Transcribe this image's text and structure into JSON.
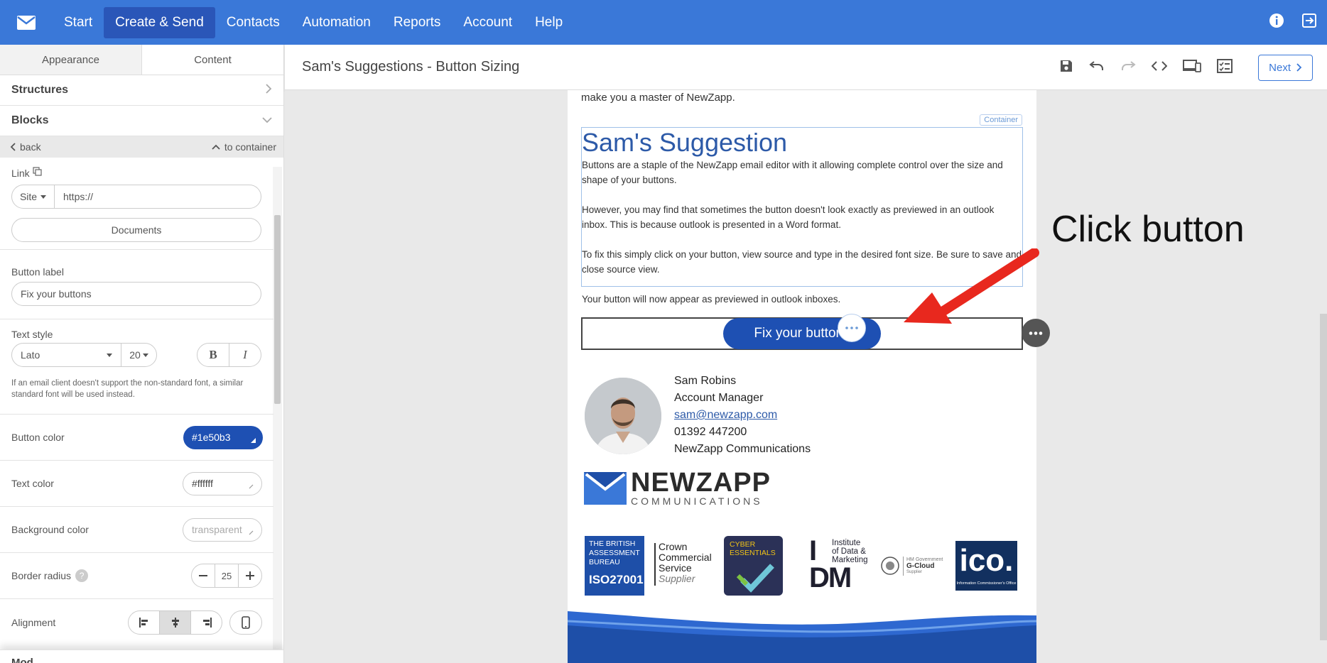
{
  "nav": {
    "items": [
      {
        "label": "Start"
      },
      {
        "label": "Create & Send"
      },
      {
        "label": "Contacts"
      },
      {
        "label": "Automation"
      },
      {
        "label": "Reports"
      },
      {
        "label": "Account"
      },
      {
        "label": "Help"
      }
    ],
    "active": "Create & Send"
  },
  "left_panel": {
    "tabs": [
      {
        "label": "Appearance"
      },
      {
        "label": "Content"
      }
    ],
    "structures_label": "Structures",
    "blocks_label": "Blocks",
    "back_label": "back",
    "to_container_label": "to container",
    "link_label": "Link",
    "link_type": "Site",
    "link_value": "https://",
    "documents_label": "Documents",
    "button_label_label": "Button label",
    "button_label_value": "Fix your buttons",
    "text_style_label": "Text style",
    "font_value": "Lato",
    "font_size": "20",
    "bold_label": "B",
    "italic_label": "I",
    "font_hint": "If an email client doesn't support the non-standard font, a similar standard font will be used instead.",
    "button_color_label": "Button color",
    "button_color_value": "#1e50b3",
    "text_color_label": "Text color",
    "text_color_value": "#ffffff",
    "background_color_label": "Background color",
    "background_color_value": "transparent",
    "border_radius_label": "Border radius",
    "border_radius_value": "25",
    "alignment_label": "Alignment",
    "cut_label": "Mod..."
  },
  "editor": {
    "title": "Sam's Suggestions - Button Sizing",
    "next_label": "Next"
  },
  "email": {
    "top_text": "make you a master of NewZapp.",
    "container_tag": "Container",
    "heading": "Sam's Suggestion",
    "para1": "Buttons are a staple of the NewZapp email editor with it allowing complete control over the size and shape of your buttons.",
    "para2": "However, you may find that sometimes the button doesn't look exactly as previewed in an outlook inbox. This is because outlook is presented in a Word format.",
    "para3": "To fix this simply click on your button, view source and type in the desired font size. Be sure to save and close source view.",
    "para4": "Your button will now appear as previewed in outlook inboxes.",
    "button_label": "Fix your buttons",
    "signature": {
      "name": "Sam Robins",
      "role": "Account Manager",
      "email": "sam@newzapp.com",
      "phone": "01392 447200",
      "company": "NewZapp Communications"
    },
    "logo_main": "NEWZAPP",
    "logo_sub": "COMMUNICATIONS",
    "badges": {
      "bab_line1": "THE BRITISH",
      "bab_line2": "ASSESSMENT",
      "bab_line3": "BUREAU",
      "bab_iso": "ISO27001",
      "ccs_line1": "Crown",
      "ccs_line2": "Commercial",
      "ccs_line3": "Service",
      "ccs_line4": "Supplier",
      "cyber_line1": "CYBER",
      "cyber_line2": "ESSENTIALS",
      "idm_line1": "Institute",
      "idm_line2": "of Data &",
      "idm_line3": "Marketing",
      "gcloud_line1": "HM Government",
      "gcloud_line2": "G-Cloud",
      "gcloud_line3": "Supplier",
      "ico": "ico.",
      "ico_sub": "Information Commissioner's Office"
    }
  },
  "annotation": "Click button",
  "colors": {
    "nav_bg": "#3a78d8",
    "nav_active": "#2a56b8",
    "button": "#1e50b3",
    "arrow": "#e8281e",
    "heading": "#2d5aa8"
  }
}
